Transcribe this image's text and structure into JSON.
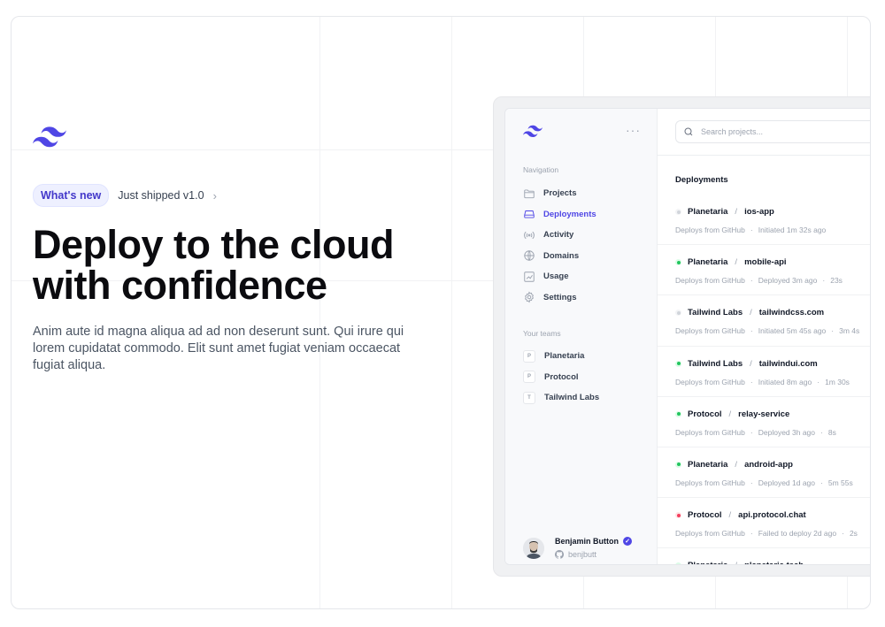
{
  "hero": {
    "badge": "What's new",
    "shipped": "Just shipped v1.0",
    "title": "Deploy to the cloud with confidence",
    "lede": "Anim aute id magna aliqua ad ad non deserunt sunt. Qui irure qui lorem cupidatat commodo. Elit sunt amet fugiat veniam occaecat fugiat aliqua."
  },
  "colors": {
    "accent": "#4f46e5",
    "green": "#22c55e",
    "red": "#f43f5e",
    "gray": "#d1d5db"
  },
  "app": {
    "search_placeholder": "Search projects...",
    "nav_label": "Navigation",
    "nav": [
      {
        "label": "Projects",
        "icon": "folder-icon"
      },
      {
        "label": "Deployments",
        "icon": "server-icon",
        "active": true
      },
      {
        "label": "Activity",
        "icon": "signal-icon"
      },
      {
        "label": "Domains",
        "icon": "globe-icon"
      },
      {
        "label": "Usage",
        "icon": "chart-icon"
      },
      {
        "label": "Settings",
        "icon": "gear-icon"
      }
    ],
    "teams_label": "Your teams",
    "teams": [
      {
        "initial": "P",
        "name": "Planetaria"
      },
      {
        "initial": "P",
        "name": "Protocol"
      },
      {
        "initial": "T",
        "name": "Tailwind Labs"
      }
    ],
    "user": {
      "name": "Benjamin Button",
      "handle": "benjbutt"
    },
    "deployments_title": "Deployments",
    "deployments": [
      {
        "team": "Planetaria",
        "project": "ios-app",
        "source": "Deploys from GitHub",
        "status": "Initiated 1m 32s ago",
        "duration": "",
        "state": "gray"
      },
      {
        "team": "Planetaria",
        "project": "mobile-api",
        "source": "Deploys from GitHub",
        "status": "Deployed 3m ago",
        "duration": "23s",
        "state": "green"
      },
      {
        "team": "Tailwind Labs",
        "project": "tailwindcss.com",
        "source": "Deploys from GitHub",
        "status": "Initiated 5m 45s ago",
        "duration": "3m 4s",
        "state": "gray"
      },
      {
        "team": "Tailwind Labs",
        "project": "tailwindui.com",
        "source": "Deploys from GitHub",
        "status": "Initiated 8m ago",
        "duration": "1m 30s",
        "state": "green"
      },
      {
        "team": "Protocol",
        "project": "relay-service",
        "source": "Deploys from GitHub",
        "status": "Deployed 3h ago",
        "duration": "8s",
        "state": "green"
      },
      {
        "team": "Planetaria",
        "project": "android-app",
        "source": "Deploys from GitHub",
        "status": "Deployed 1d ago",
        "duration": "5m 55s",
        "state": "green"
      },
      {
        "team": "Protocol",
        "project": "api.protocol.chat",
        "source": "Deploys from GitHub",
        "status": "Failed to deploy 2d ago",
        "duration": "2s",
        "state": "red"
      },
      {
        "team": "Planetaria",
        "project": "planetaria.tech",
        "source": "",
        "status": "",
        "duration": "",
        "state": "green"
      }
    ]
  }
}
